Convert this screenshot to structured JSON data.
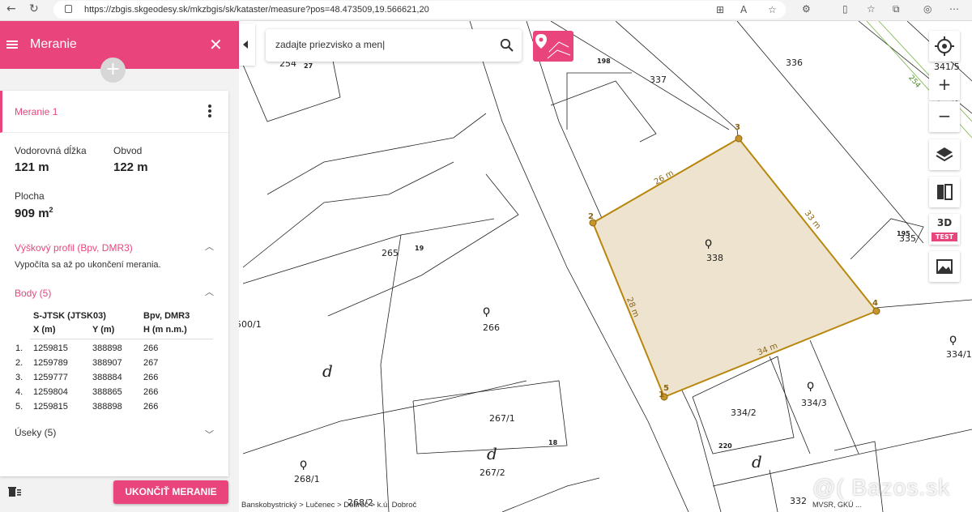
{
  "browser": {
    "url": "https://zbgis.skgeodesy.sk/mkzbgis/sk/kataster/measure?pos=48.473509,19.566621,20"
  },
  "panel": {
    "title": "Meranie",
    "measurement_name": "Meranie 1",
    "horizontal_length_label": "Vodorovná dĺžka",
    "horizontal_length_value": "121 m",
    "perimeter_label": "Obvod",
    "perimeter_value": "122 m",
    "area_label": "Plocha",
    "area_value": "909 m",
    "area_unit_sup": "2",
    "profile_title": "Výškový profil (Bpv, DMR3)",
    "profile_note": "Vypočíta sa až po ukončení merania.",
    "points_title": "Body (5)",
    "points_headers": {
      "coord_system": "S-JTSK (JTSK03)",
      "height_system": "Bpv, DMR3",
      "x": "X (m)",
      "y": "Y (m)",
      "h": "H (m n.m.)"
    },
    "points": [
      {
        "n": "1.",
        "x": "1259815",
        "y": "388898",
        "h": "266"
      },
      {
        "n": "2.",
        "x": "1259789",
        "y": "388907",
        "h": "267"
      },
      {
        "n": "3.",
        "x": "1259777",
        "y": "388884",
        "h": "266"
      },
      {
        "n": "4.",
        "x": "1259804",
        "y": "388865",
        "h": "266"
      },
      {
        "n": "5.",
        "x": "1259815",
        "y": "388898",
        "h": "266"
      }
    ],
    "segments_title": "Úseky (5)",
    "finish_button": "UKONČIŤ MERANIE"
  },
  "map": {
    "search_placeholder": "zadajte priezvisko a men|",
    "badge_3d": "3D",
    "badge_test": "TEST",
    "breadcrumb": "Banskobystrický > Lučenec > Dobroč > k.ú. Dobroč",
    "attribution": "MVSR, GKÚ ...",
    "watermark": "@( Bazos.sk",
    "parcel_labels": [
      {
        "text": "254"
      },
      {
        "text": "27"
      },
      {
        "text": "198"
      },
      {
        "text": "337"
      },
      {
        "text": "336"
      },
      {
        "text": "341/5"
      },
      {
        "text": "254"
      },
      {
        "text": "265"
      },
      {
        "text": "19"
      },
      {
        "text": "338"
      },
      {
        "text": "195"
      },
      {
        "text": "335"
      },
      {
        "text": "500/1"
      },
      {
        "text": "266"
      },
      {
        "text": "334/1"
      },
      {
        "text": "267/1"
      },
      {
        "text": "18"
      },
      {
        "text": "334/2"
      },
      {
        "text": "334/3"
      },
      {
        "text": "220"
      },
      {
        "text": "268/1"
      },
      {
        "text": "267/2"
      },
      {
        "text": "332"
      },
      {
        "text": "268/2"
      }
    ],
    "segment_labels": [
      "26 m",
      "33 m",
      "28 m",
      "34 m"
    ],
    "vertex_labels": [
      "1",
      "2",
      "3",
      "4",
      "5"
    ]
  },
  "colors": {
    "accent": "#e9457c",
    "polygon_fill": "#ede3cf",
    "polygon_stroke": "#b8860b"
  }
}
